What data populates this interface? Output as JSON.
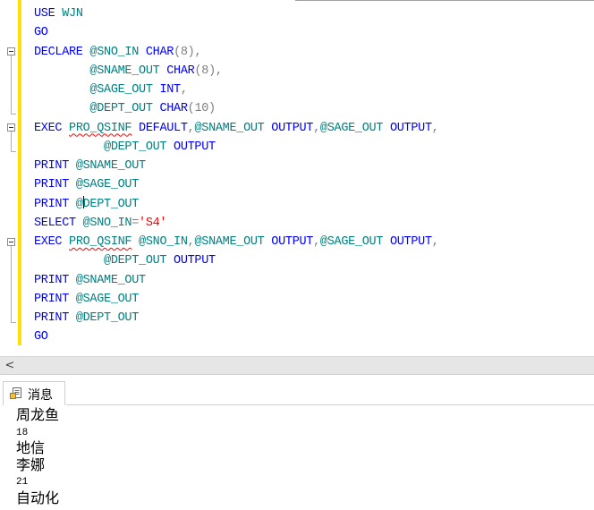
{
  "editor": {
    "lines": [
      [
        {
          "t": "USE ",
          "c": "kw"
        },
        {
          "t": "WJN",
          "c": "var"
        }
      ],
      [
        {
          "t": "GO",
          "c": "kw"
        }
      ],
      [
        {
          "t": "DECLARE ",
          "c": "kw"
        },
        {
          "t": "@SNO_IN ",
          "c": "var"
        },
        {
          "t": "CHAR",
          "c": "kw"
        },
        {
          "t": "(8),",
          "c": "gray"
        }
      ],
      [
        {
          "t": "        ",
          "c": "gray"
        },
        {
          "t": "@SNAME_OUT ",
          "c": "var"
        },
        {
          "t": "CHAR",
          "c": "kw"
        },
        {
          "t": "(8),",
          "c": "gray"
        }
      ],
      [
        {
          "t": "        ",
          "c": "gray"
        },
        {
          "t": "@SAGE_OUT ",
          "c": "var"
        },
        {
          "t": "INT",
          "c": "kw"
        },
        {
          "t": ",",
          "c": "gray"
        }
      ],
      [
        {
          "t": "        ",
          "c": "gray"
        },
        {
          "t": "@DEPT_OUT ",
          "c": "var"
        },
        {
          "t": "CHAR",
          "c": "kw"
        },
        {
          "t": "(10)",
          "c": "gray"
        }
      ],
      [
        {
          "t": "EXEC ",
          "c": "kw"
        },
        {
          "t": "PRO_QSINF",
          "c": "squig"
        },
        {
          "t": " ",
          "c": "gray"
        },
        {
          "t": "DEFAULT",
          "c": "kw"
        },
        {
          "t": ",",
          "c": "gray"
        },
        {
          "t": "@SNAME_OUT ",
          "c": "var"
        },
        {
          "t": "OUTPUT",
          "c": "kw"
        },
        {
          "t": ",",
          "c": "gray"
        },
        {
          "t": "@SAGE_OUT ",
          "c": "var"
        },
        {
          "t": "OUTPUT",
          "c": "kw"
        },
        {
          "t": ",",
          "c": "gray"
        }
      ],
      [
        {
          "t": "          ",
          "c": "gray"
        },
        {
          "t": "@DEPT_OUT ",
          "c": "var"
        },
        {
          "t": "OUTPUT",
          "c": "kw"
        }
      ],
      [
        {
          "t": "PRINT ",
          "c": "kw"
        },
        {
          "t": "@SNAME_OUT",
          "c": "var"
        }
      ],
      [
        {
          "t": "PRINT ",
          "c": "kw"
        },
        {
          "t": "@SAGE_OUT",
          "c": "var"
        }
      ],
      [
        {
          "t": "PRINT ",
          "c": "kw"
        },
        {
          "t": "@",
          "c": "var"
        },
        {
          "t": "",
          "c": "caret"
        },
        {
          "t": "DEPT_OUT",
          "c": "var"
        }
      ],
      [
        {
          "t": "SELECT ",
          "c": "kw"
        },
        {
          "t": "@SNO_IN",
          "c": "var"
        },
        {
          "t": "=",
          "c": "gray"
        },
        {
          "t": "'S4'",
          "c": "str"
        }
      ],
      [
        {
          "t": "EXEC ",
          "c": "kw"
        },
        {
          "t": "PRO_QSINF",
          "c": "squig"
        },
        {
          "t": " ",
          "c": "gray"
        },
        {
          "t": "@SNO_IN",
          "c": "var"
        },
        {
          "t": ",",
          "c": "gray"
        },
        {
          "t": "@SNAME_OUT ",
          "c": "var"
        },
        {
          "t": "OUTPUT",
          "c": "kw"
        },
        {
          "t": ",",
          "c": "gray"
        },
        {
          "t": "@SAGE_OUT ",
          "c": "var"
        },
        {
          "t": "OUTPUT",
          "c": "kw"
        },
        {
          "t": ",",
          "c": "gray"
        }
      ],
      [
        {
          "t": "          ",
          "c": "gray"
        },
        {
          "t": "@DEPT_OUT ",
          "c": "var"
        },
        {
          "t": "OUTPUT",
          "c": "kw"
        }
      ],
      [
        {
          "t": "PRINT ",
          "c": "kw"
        },
        {
          "t": "@SNAME_OUT",
          "c": "var"
        }
      ],
      [
        {
          "t": "PRINT ",
          "c": "kw"
        },
        {
          "t": "@SAGE_OUT",
          "c": "var"
        }
      ],
      [
        {
          "t": "PRINT ",
          "c": "kw"
        },
        {
          "t": "@DEPT_OUT",
          "c": "var"
        }
      ],
      [
        {
          "t": "GO",
          "c": "kw"
        }
      ]
    ]
  },
  "scrollbar": {
    "left_arrow_icon": "chevron-left-icon",
    "left_arrow_glyph": "<"
  },
  "messages_tab": {
    "label": "消息",
    "icon": "message-document-icon"
  },
  "messages": [
    {
      "text": "周龙鱼",
      "kind": "cjk"
    },
    {
      "text": "18",
      "kind": "num"
    },
    {
      "text": "地信",
      "kind": "cjk"
    },
    {
      "text": "李娜",
      "kind": "cjk"
    },
    {
      "text": "21",
      "kind": "num"
    },
    {
      "text": "自动化",
      "kind": "cjk"
    }
  ],
  "colors": {
    "keyword": "#0000ff",
    "variable": "#008080",
    "punctuation": "#808080",
    "string": "#ff0000",
    "change_bar": "#ffe000"
  }
}
